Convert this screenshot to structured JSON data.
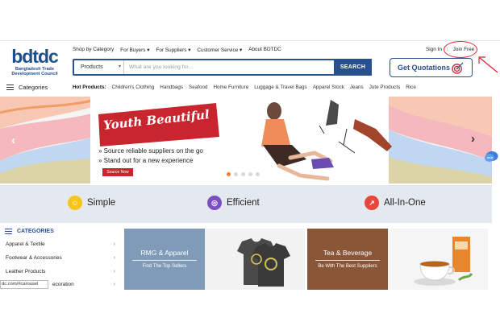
{
  "brand": {
    "logo_text": "bdtdc",
    "subtitle_line1": "Bangladesh Trade",
    "subtitle_line2": "Development Council"
  },
  "top_nav": [
    {
      "label": "Shop by Category"
    },
    {
      "label": "For Buyers ▾"
    },
    {
      "label": "For Suppliers ▾"
    },
    {
      "label": "Customer Service ▾"
    },
    {
      "label": "About BDTDC"
    }
  ],
  "account": {
    "sign_in": "Sign In",
    "join_free": "Join Free"
  },
  "search": {
    "category": "Products",
    "placeholder": "What are you looking for...",
    "button": "SEARCH"
  },
  "quotations": {
    "label": "Get Quotations"
  },
  "categories_toggle": {
    "label": "Categories"
  },
  "hot_products": {
    "lead": "Hot Products:",
    "items": [
      "Children's Clothing",
      "Handbags",
      "Seafood",
      "Home Furniture",
      "Luggage & Travel Bags",
      "Apparel Stock",
      "Jeans",
      "Jute Products",
      "Rice"
    ]
  },
  "banner": {
    "title": "Youth Beautiful",
    "line1": "» Source reliable suppliers on the go",
    "line2": "» Stand out for a new experience",
    "cta": "Source Now",
    "slides": 5,
    "active_slide": 1
  },
  "features": [
    {
      "label": "Simple",
      "icon": "smile-icon",
      "color": "#f5c518"
    },
    {
      "label": "Efficient",
      "icon": "target-icon",
      "color": "#7b4fc4"
    },
    {
      "label": "All-In-One",
      "icon": "chart-icon",
      "color": "#e8453c"
    }
  ],
  "sidebar": {
    "title": "CATEGORIES",
    "items": [
      {
        "label": "Apparel & Textile"
      },
      {
        "label": "Footwear & Accessories"
      },
      {
        "label": "Leather Products"
      },
      {
        "label": "ecoration"
      }
    ]
  },
  "status_url": "dc.com/#carousel",
  "promos": [
    {
      "title": "RMG & Apparel",
      "subtitle": "Find The Top Sellers",
      "color": "#7f9bb8"
    },
    {
      "title": "Tea & Beverage",
      "subtitle": "Be With The Best Suppliers",
      "color": "#8a5638"
    }
  ],
  "colors": {
    "brand_blue": "#29508e",
    "accent_orange": "#f07f2e",
    "annotation_red": "#d22233"
  }
}
